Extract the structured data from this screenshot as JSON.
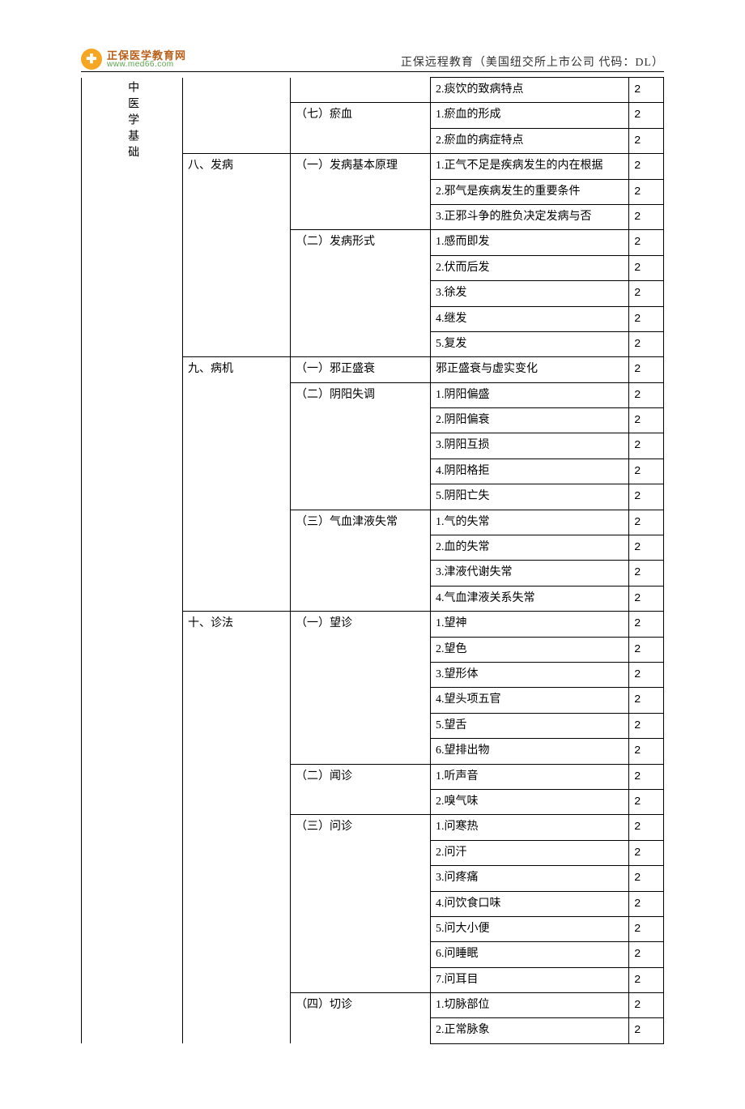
{
  "header": {
    "logo_cn": "正保医学教育网",
    "logo_url": "www.med66.com",
    "center": "正保远程教育（美国纽交所上市公司  代码：DL）"
  },
  "col1_label": "中医学基础",
  "rows": [
    {
      "c2": "",
      "c3": "",
      "c4": "2.痰饮的致病特点",
      "c5": "2",
      "b2": "nt nb",
      "b3": "nt nb",
      "b1": "nt nb"
    },
    {
      "c2": "",
      "c3": "（七）瘀血",
      "c4": "1.瘀血的形成",
      "c5": "2",
      "b2": "nt nb",
      "b3": "nb",
      "b1": "nt nb"
    },
    {
      "c2": "",
      "c3": "",
      "c4": "2.瘀血的病症特点",
      "c5": "2",
      "b2": "nt",
      "b3": "nt",
      "b1": "nt nb"
    },
    {
      "c2": "八、发病",
      "c3": "（一）发病基本原理",
      "c4": "1.正气不足是疾病发生的内在根据",
      "c5": "2",
      "b2": "nb",
      "b3": "nb",
      "b1": "nt nb"
    },
    {
      "c2": "",
      "c3": "",
      "c4": "2.邪气是疾病发生的重要条件",
      "c5": "2",
      "b2": "nt nb",
      "b3": "nt nb",
      "b1": "nt nb"
    },
    {
      "c2": "",
      "c3": "",
      "c4": "3.正邪斗争的胜负决定发病与否",
      "c5": "2",
      "b2": "nt nb",
      "b3": "nt",
      "b1": "nt nb"
    },
    {
      "c2": "",
      "c3": "（二）发病形式",
      "c4": "1.感而即发",
      "c5": "2",
      "b2": "nt nb",
      "b3": "nb",
      "b1": "nt nb"
    },
    {
      "c2": "",
      "c3": "",
      "c4": "2.伏而后发",
      "c5": "2",
      "b2": "nt nb",
      "b3": "nt nb",
      "b1": "nt nb"
    },
    {
      "c2": "",
      "c3": "",
      "c4": "3.徐发",
      "c5": "2",
      "b2": "nt nb",
      "b3": "nt nb",
      "b1": "nt nb"
    },
    {
      "c2": "",
      "c3": "",
      "c4": "4.继发",
      "c5": "2",
      "b2": "nt nb",
      "b3": "nt nb",
      "b1": "nt nb"
    },
    {
      "c2": "",
      "c3": "",
      "c4": "5.复发",
      "c5": "2",
      "b2": "nt",
      "b3": "nt",
      "b1": "nt nb"
    },
    {
      "c2": "九、病机",
      "c3": "（一）邪正盛衰",
      "c4": "邪正盛衰与虚实变化",
      "c5": "2",
      "b2": "nb",
      "b3": "",
      "b1": "nt nb"
    },
    {
      "c2": "",
      "c3": "（二）阴阳失调",
      "c4": "1.阴阳偏盛",
      "c5": "2",
      "b2": "nt nb",
      "b3": "nb",
      "b1": "nt nb"
    },
    {
      "c2": "",
      "c3": "",
      "c4": "2.阴阳偏衰",
      "c5": "2",
      "b2": "nt nb",
      "b3": "nt nb",
      "b1": "nt nb"
    },
    {
      "c2": "",
      "c3": "",
      "c4": "3.阴阳互损",
      "c5": "2",
      "b2": "nt nb",
      "b3": "nt nb",
      "b1": "nt nb"
    },
    {
      "c2": "",
      "c3": "",
      "c4": "4.阴阳格拒",
      "c5": "2",
      "b2": "nt nb",
      "b3": "nt nb",
      "b1": "nt nb"
    },
    {
      "c2": "",
      "c3": "",
      "c4": "5.阴阳亡失",
      "c5": "2",
      "b2": "nt nb",
      "b3": "nt",
      "b1": "nt nb"
    },
    {
      "c2": "",
      "c3": "（三）气血津液失常",
      "c4": "1.气的失常",
      "c5": "2",
      "b2": "nt nb",
      "b3": "nb",
      "b1": "nt nb"
    },
    {
      "c2": "",
      "c3": "",
      "c4": "2.血的失常",
      "c5": "2",
      "b2": "nt nb",
      "b3": "nt nb",
      "b1": "nt nb"
    },
    {
      "c2": "",
      "c3": "",
      "c4": "3.津液代谢失常",
      "c5": "2",
      "b2": "nt nb",
      "b3": "nt nb",
      "b1": "nt nb"
    },
    {
      "c2": "",
      "c3": "",
      "c4": "4.气血津液关系失常",
      "c5": "2",
      "b2": "nt",
      "b3": "nt",
      "b1": "nt nb"
    },
    {
      "c2": "十、诊法",
      "c3": "（一）望诊",
      "c4": "1.望神",
      "c5": "2",
      "b2": "nb",
      "b3": "nb",
      "b1": "nt nb"
    },
    {
      "c2": "",
      "c3": "",
      "c4": "2.望色",
      "c5": "2",
      "b2": "nt nb",
      "b3": "nt nb",
      "b1": "nt nb"
    },
    {
      "c2": "",
      "c3": "",
      "c4": "3.望形体",
      "c5": "2",
      "b2": "nt nb",
      "b3": "nt nb",
      "b1": "nt nb"
    },
    {
      "c2": "",
      "c3": "",
      "c4": "4.望头项五官",
      "c5": "2",
      "b2": "nt nb",
      "b3": "nt nb",
      "b1": "nt nb"
    },
    {
      "c2": "",
      "c3": "",
      "c4": "5.望舌",
      "c5": "2",
      "b2": "nt nb",
      "b3": "nt nb",
      "b1": "nt nb"
    },
    {
      "c2": "",
      "c3": "",
      "c4": "6.望排出物",
      "c5": "2",
      "b2": "nt nb",
      "b3": "nt",
      "b1": "nt nb"
    },
    {
      "c2": "",
      "c3": "（二）闻诊",
      "c4": "1.听声音",
      "c5": "2",
      "b2": "nt nb",
      "b3": "nb",
      "b1": "nt nb"
    },
    {
      "c2": "",
      "c3": "",
      "c4": "2.嗅气味",
      "c5": "2",
      "b2": "nt nb",
      "b3": "nt",
      "b1": "nt nb"
    },
    {
      "c2": "",
      "c3": "（三）问诊",
      "c4": "1.问寒热",
      "c5": "2",
      "b2": "nt nb",
      "b3": "nb",
      "b1": "nt nb"
    },
    {
      "c2": "",
      "c3": "",
      "c4": "2.问汗",
      "c5": "2",
      "b2": "nt nb",
      "b3": "nt nb",
      "b1": "nt nb"
    },
    {
      "c2": "",
      "c3": "",
      "c4": "3.问疼痛",
      "c5": "2",
      "b2": "nt nb",
      "b3": "nt nb",
      "b1": "nt nb"
    },
    {
      "c2": "",
      "c3": "",
      "c4": "4.问饮食口味",
      "c5": "2",
      "b2": "nt nb",
      "b3": "nt nb",
      "b1": "nt nb"
    },
    {
      "c2": "",
      "c3": "",
      "c4": "5.问大小便",
      "c5": "2",
      "b2": "nt nb",
      "b3": "nt nb",
      "b1": "nt nb"
    },
    {
      "c2": "",
      "c3": "",
      "c4": "6.问睡眠",
      "c5": "2",
      "b2": "nt nb",
      "b3": "nt nb",
      "b1": "nt nb"
    },
    {
      "c2": "",
      "c3": "",
      "c4": "7.问耳目",
      "c5": "2",
      "b2": "nt nb",
      "b3": "nt",
      "b1": "nt nb"
    },
    {
      "c2": "",
      "c3": "（四）切诊",
      "c4": "1.切脉部位",
      "c5": "2",
      "b2": "nt nb",
      "b3": "nb",
      "b1": "nt nb"
    },
    {
      "c2": "",
      "c3": "",
      "c4": "2.正常脉象",
      "c5": "2",
      "b2": "nt nb",
      "b3": "nt nb",
      "b1": "nt nb"
    }
  ]
}
